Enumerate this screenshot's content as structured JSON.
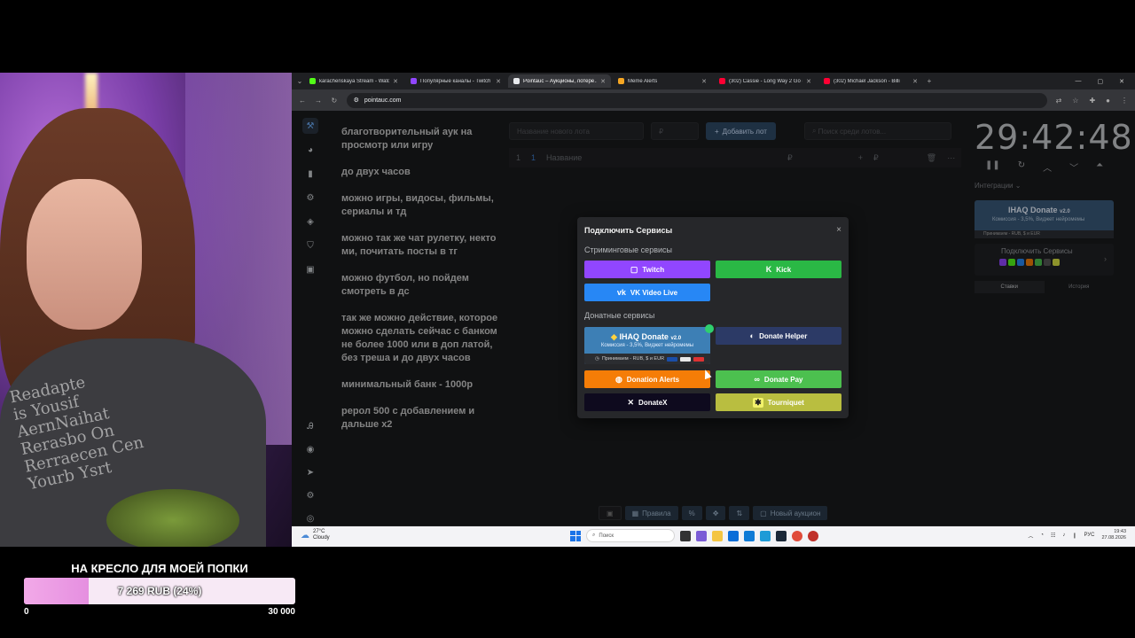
{
  "donation_goal": {
    "title": "НА КРЕСЛО ДЛЯ МОЕЙ ПОПКИ",
    "amount_text": "7 269 RUB (24%)",
    "progress": 0.24,
    "min": "0",
    "max": "30 000"
  },
  "browser": {
    "tabs": [
      {
        "label": "karachenskaya Stream - Watch",
        "color": "#53fc18"
      },
      {
        "label": "Популярные каналы - Twitch",
        "color": "#9146ff"
      },
      {
        "label": "Pointauc – Аукционы, лотере…",
        "color": "#e8eaed",
        "active": true
      },
      {
        "label": "Meme Alerts",
        "color": "#f5a623"
      },
      {
        "label": "(302) Cassie - Long Way 2 Go (",
        "color": "#ff0033"
      },
      {
        "label": "(302) Michael Jackson - Billi",
        "color": "#ff0033"
      }
    ],
    "new_tab": "+",
    "url": "pointauc.com"
  },
  "notes": "благотворительный аук на просмотр или игру\n\nдо  двух часов\n\nможно игры, видосы, фильмы, сериалы и тд\n\nможно так же чат рулетку, некто ми, почитать посты в тг\n\nможно футбол, но пойдем смотреть в дс\n\nтак же можно действие, которое можно сделать сейчас с банком не более 1000 или в доп латой, без треша  и до двух часов\n\nминимальный банк - 1000р\n\nрерол 500 с добавлением и дальше х2",
  "toolbar": {
    "lot_name_placeholder": "Название нового лота",
    "amount_placeholder": "₽",
    "add_button": "Добавить лот",
    "search_placeholder": "Поиск среди лотов..."
  },
  "lot_row": {
    "index": "1",
    "id": "1",
    "name_placeholder": "Название",
    "currency": "₽"
  },
  "timer": {
    "value": "29:42:48"
  },
  "sidebar_right": {
    "integrations_label": "Интеграции",
    "ihaq_title": "IHAQ Donate",
    "ihaq_version": "v2.0",
    "ihaq_sub": "Комиссия - 3,5%, Виджет нейромемы",
    "ihaq_bottom": "Принимаем - RUB, $ и EUR",
    "connect_title": "Подключить Сервисы",
    "tab_bets": "Ставки",
    "tab_history": "История"
  },
  "bottom_bar": {
    "rules": "Правила",
    "new_auction": "Новый аукцион"
  },
  "modal": {
    "title": "Подключить Сервисы",
    "close": "×",
    "streaming_label": "Стриминговые сервисы",
    "donation_label": "Донатные сервисы",
    "twitch": "Twitch",
    "kick": "Kick",
    "vk": "VK Video Live",
    "ihaq_title": "IHAQ Donate",
    "ihaq_version": "v2.0",
    "ihaq_sub": "Комиссия - 3,5%, Виджет нейромемы",
    "ihaq_bottom": "Принимаем - RUB, $ и EUR",
    "donate_helper": "Donate Helper",
    "donation_alerts": "Donation Alerts",
    "donate_pay": "Donate Pay",
    "donatex": "DonateX",
    "tourniquet": "Tourniquet"
  },
  "taskbar": {
    "temp": "27°C",
    "weather": "Cloudy",
    "search": "Поиск",
    "lang": "РУС",
    "time": "19:43",
    "date": "27.08.2026"
  },
  "webcam": {
    "shirt_text": "Readapte\nis Yousif\nAernNaihat\nRerasbo On\nRerraecen Cen\nYourb Ysrt"
  },
  "colors": {
    "twitch": "#9146ff",
    "kick": "#2ab845",
    "vk": "#2787f5",
    "donation_alerts": "#f57d07",
    "donate_pay": "#4cc04f",
    "donatex": "#0e0a1e",
    "tourniquet": "#b9be40",
    "donate_helper": "#2c3a66"
  }
}
